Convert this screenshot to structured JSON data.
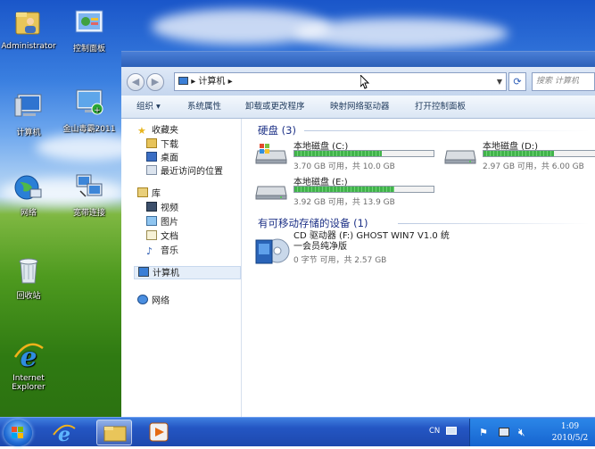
{
  "desktop": {
    "icons": [
      {
        "label": "Administrator",
        "icon": "user-folder-icon"
      },
      {
        "label": "控制面板",
        "icon": "control-panel-icon"
      },
      {
        "label": "计算机",
        "icon": "computer-icon"
      },
      {
        "label": "金山毒霸2011",
        "icon": "antivirus-icon"
      },
      {
        "label": "网络",
        "icon": "network-icon"
      },
      {
        "label": "宽带连接",
        "icon": "broadband-icon"
      },
      {
        "label": "回收站",
        "icon": "recycle-bin-icon"
      },
      {
        "label": "Internet Explorer",
        "icon": "ie-icon"
      }
    ]
  },
  "explorer": {
    "address": {
      "arrow": "▸",
      "path": "计算机",
      "trail": "▸"
    },
    "search": {
      "placeholder": "搜索 计算机"
    },
    "toolbar": {
      "organize": "组织 ▾",
      "system_properties": "系统属性",
      "uninstall": "卸载或更改程序",
      "map_drive": "映射网络驱动器",
      "open_control_panel": "打开控制面板"
    },
    "nav": {
      "favorites": "收藏夹",
      "downloads": "下载",
      "desktop": "桌面",
      "recent": "最近访问的位置",
      "libraries": "库",
      "videos": "视频",
      "pictures": "图片",
      "documents": "文档",
      "music": "音乐",
      "computer": "计算机",
      "network": "网络"
    },
    "hard_disks": {
      "title": "硬盘 (3)",
      "drives": [
        {
          "name": "本地磁盘 (C:)",
          "free": "3.70 GB 可用，共 10.0 GB",
          "used_fraction": 0.63
        },
        {
          "name": "本地磁盘 (D:)",
          "free": "2.97 GB 可用，共 6.00 GB",
          "used_fraction": 0.505
        },
        {
          "name": "本地磁盘 (E:)",
          "free": "3.92 GB 可用，共 13.9 GB",
          "used_fraction": 0.72
        }
      ]
    },
    "removable": {
      "title": "有可移动存储的设备 (1)",
      "cd_name_line1": "CD 驱动器 (F:) GHOST WIN7 V1.0 统",
      "cd_name_line2": "一会员纯净版",
      "cd_free": "0 字节 可用，共 2.57 GB"
    }
  },
  "taskbar": {
    "lang": "CN",
    "time": "1:09",
    "date": "2010/5/2"
  },
  "colors": {
    "window_frame": "#3d6bbf",
    "section_title": "#1e3287",
    "bar_fill": "#41b34b"
  }
}
